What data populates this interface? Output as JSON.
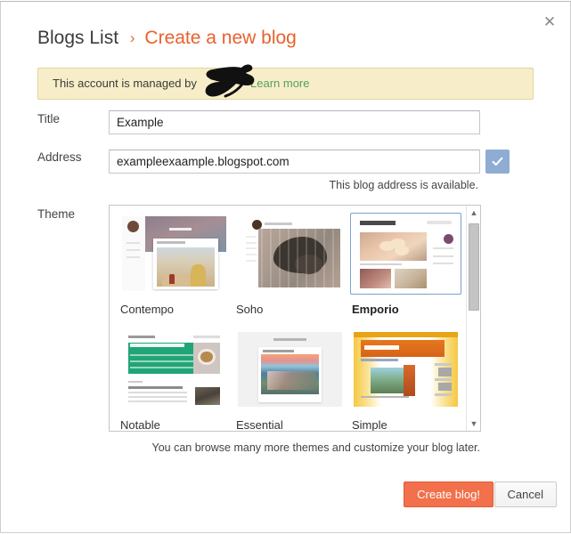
{
  "dialog": {
    "close_label": "✕",
    "breadcrumb": {
      "root": "Blogs List",
      "separator": "›",
      "current": "Create a new blog"
    },
    "notice": {
      "text": "This account is managed by",
      "link": "Learn more",
      "redaction": "black-scribble-redaction"
    },
    "fields": {
      "title": {
        "label": "Title",
        "value": "Example",
        "placeholder": ""
      },
      "address": {
        "label": "Address",
        "value": "exampleexaample.blogspot.com",
        "placeholder": "",
        "check_icon": "check-icon",
        "status": "This blog address is available."
      },
      "theme": {
        "label": "Theme"
      }
    },
    "themes": {
      "rows": [
        [
          {
            "name": "Contempo",
            "selected": false,
            "art": "t-contempo"
          },
          {
            "name": "Soho",
            "selected": false,
            "art": "t-soho"
          },
          {
            "name": "Emporio",
            "selected": true,
            "art": "t-emporio"
          }
        ],
        [
          {
            "name": "Notable",
            "selected": false,
            "art": "t-notable"
          },
          {
            "name": "Essential",
            "selected": false,
            "art": "t-essential"
          },
          {
            "name": "Simple",
            "selected": false,
            "art": "t-simple"
          }
        ]
      ],
      "scroll": {
        "up_icon": "▲",
        "down_icon": "▼"
      },
      "hint": "You can browse many more themes and customize your blog later."
    },
    "footer": {
      "create_label": "Create blog!",
      "cancel_label": "Cancel"
    },
    "colors": {
      "accent_orange": "#e8622c",
      "create_button": "#f2704b",
      "notice_background": "#f7eec9",
      "notice_border": "#e2d39a",
      "link_green": "#57a05a",
      "check_button_blue": "#8fadd3",
      "selected_theme_border": "#7ba0cc"
    }
  }
}
